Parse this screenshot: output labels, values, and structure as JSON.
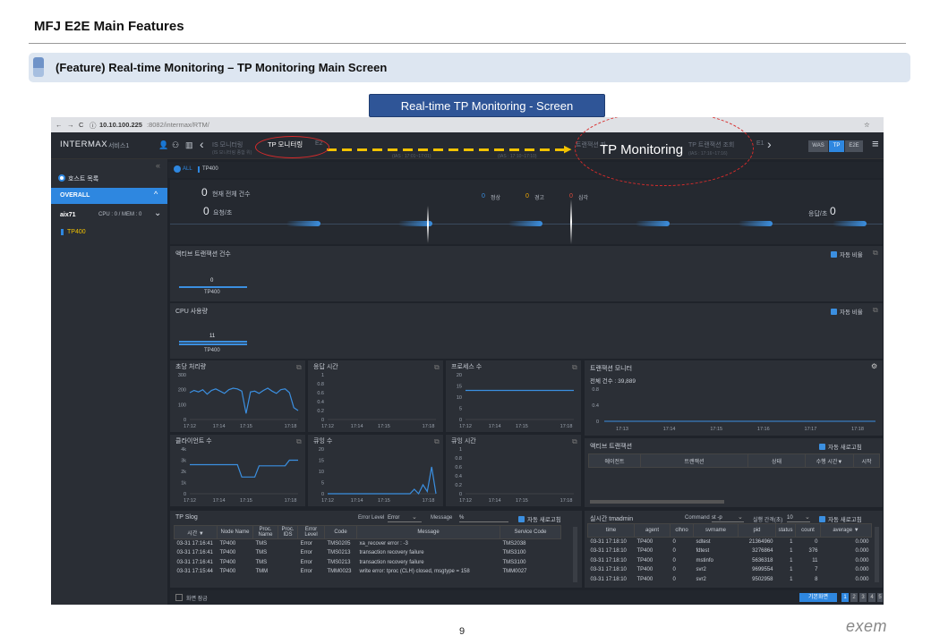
{
  "slide": {
    "title": "MFJ E2E Main Features",
    "feature_heading": "(Feature) Real-time Monitoring – TP Monitoring Main Screen",
    "screen_label": "Real-time TP Monitoring - Screen",
    "page_number": "9",
    "logo": "exem",
    "callout": "TP Monitoring"
  },
  "browser": {
    "url_host": "10.10.100.225",
    "url_rest": ":8082/intermax/RTM/"
  },
  "app": {
    "brand": "INTERMAX",
    "service": "서비스1",
    "nav_items": [
      "IS 모니터링",
      "TP 모니터링",
      "E2",
      "트랜잭션 파",
      "TP 트랜잭션 조회",
      "E1"
    ],
    "nav_sub": [
      "(IS 모니터링 종합 위)",
      "(IAS : 17:01~17:01)",
      "(IAS : 17:10~17:10)",
      "(IAS : 17:16~17:16)"
    ],
    "view_buttons": [
      "WAS",
      "TP",
      "E2E"
    ]
  },
  "sidebar": {
    "host_list": "호스트 목록",
    "overall": "OVERALL",
    "host": "aix71",
    "host_stats": "CPU : 0 / MEM : 0",
    "tp_item": "TP400"
  },
  "filter": {
    "all": "ALL",
    "tp": "TP400"
  },
  "summary": {
    "total_label": "현재 전체 건수",
    "total_value": "0",
    "req_label": "요청/초",
    "req_value": "0",
    "normal_value": "0",
    "normal_label": "정상",
    "warn_value": "0",
    "warn_label": "경고",
    "crit_value": "0",
    "crit_label": "심각",
    "resp_label": "응답/초",
    "resp_value": "0"
  },
  "active_panel": {
    "title": "액티브 트랜잭션 건수",
    "auto_ratio": "자동 비율",
    "value": "0",
    "server": "TP400"
  },
  "cpu_panel": {
    "title": "CPU 사용량",
    "auto_ratio": "자동 비율",
    "value": "11",
    "server": "TP400"
  },
  "chart_data": [
    {
      "type": "line",
      "title": "초당 처리량",
      "x": [
        "17:12",
        "17:14",
        "17:15",
        "17:18"
      ],
      "ylim": [
        0,
        300
      ],
      "yticks": [
        "300",
        "200",
        "100",
        "0"
      ],
      "values": [
        180,
        195,
        185,
        200,
        170,
        195,
        205,
        190,
        175,
        200,
        210,
        205,
        190,
        40,
        185,
        190,
        175,
        195,
        210,
        190,
        175,
        200,
        205,
        180,
        80,
        60
      ]
    },
    {
      "type": "line",
      "title": "응답 시간",
      "x": [
        "17:12",
        "17:14",
        "17:15",
        "17:18"
      ],
      "ylim": [
        0,
        1
      ],
      "yticks": [
        "1",
        "0.8",
        "0.6",
        "0.4",
        "0.2",
        "0"
      ],
      "values": []
    },
    {
      "type": "line",
      "title": "프로세스 수",
      "x": [
        "17:12",
        "17:14",
        "17:15",
        "17:18"
      ],
      "ylim": [
        0,
        20
      ],
      "yticks": [
        "20",
        "15",
        "10",
        "5",
        "0"
      ],
      "values": [
        13,
        13,
        13,
        13,
        13,
        13,
        13,
        13,
        13,
        13,
        13,
        13,
        13,
        13
      ]
    },
    {
      "type": "line",
      "title": "클라이언트 수",
      "x": [
        "17:12",
        "17:14",
        "17:15",
        "17:18"
      ],
      "ylim": [
        0,
        4000
      ],
      "yticks": [
        "4k",
        "3k",
        "2k",
        "1k",
        "0"
      ],
      "values": [
        2600,
        2600,
        2600,
        2600,
        2600,
        2600,
        2600,
        2600,
        2600,
        2600,
        2600,
        2600,
        1500,
        1500,
        1500,
        1500,
        2500,
        2500,
        2500,
        2500,
        2500,
        2500,
        2500,
        3000,
        3000,
        3000
      ]
    },
    {
      "type": "line",
      "title": "큐잉 수",
      "x": [
        "17:12",
        "17:14",
        "17:15",
        "17:18"
      ],
      "ylim": [
        0,
        20
      ],
      "yticks": [
        "20",
        "15",
        "10",
        "5",
        "0"
      ],
      "values": [
        0,
        0,
        0,
        0,
        0,
        0,
        0,
        0,
        0,
        0,
        0,
        0,
        0,
        0,
        0,
        0,
        0,
        0,
        0,
        0,
        2,
        0,
        4,
        1,
        12,
        0
      ]
    },
    {
      "type": "line",
      "title": "큐잉 시간",
      "x": [
        "17:12",
        "17:14",
        "17:15",
        "17:18"
      ],
      "ylim": [
        0,
        1
      ],
      "yticks": [
        "1",
        "0.8",
        "0.6",
        "0.4",
        "0.2",
        "0"
      ],
      "values": []
    },
    {
      "type": "bar",
      "title": "트랜잭션 모니터",
      "total_label": "전체 건수 : 39,889",
      "x": [
        "17:13",
        "17:14",
        "17:15",
        "17:16",
        "17:17",
        "17:18"
      ],
      "ylim": [
        0,
        1
      ],
      "yticks": [
        "0.8",
        "0.4",
        "0"
      ],
      "values": []
    }
  ],
  "active_txn": {
    "title": "액티브 트랜잭션",
    "auto_refresh": "자동 새로고침",
    "columns": [
      "에이전트",
      "트랜잭션",
      "상태",
      "수행 시간▼",
      "시작"
    ]
  },
  "slog": {
    "title": "TP Slog",
    "error_level_label": "Error Level",
    "error_level_value": "Error",
    "message_label": "Message",
    "message_value": "%",
    "auto_refresh": "자동 새로고침",
    "columns": [
      "시간 ▼",
      "Node Name",
      "Proc. Name",
      "Proc. IDS",
      "Error Level",
      "Code",
      "Message",
      "Service Code"
    ],
    "rows": [
      [
        "03-31 17:16:41",
        "TP400",
        "TMS",
        "",
        "Error",
        "TMS0205",
        "xa_recover error : -3",
        "TMS2038"
      ],
      [
        "03-31 17:16:41",
        "TP400",
        "TMS",
        "",
        "Error",
        "TMS0213",
        "transaction recovery failure",
        "TMS3100"
      ],
      [
        "03-31 17:16:41",
        "TP400",
        "TMS",
        "",
        "Error",
        "TMS0213",
        "transaction recovery failure",
        "TMS3100"
      ],
      [
        "03-31 17:15:44",
        "TP400",
        "TMM",
        "",
        "Error",
        "TMM0023",
        "write error: tproc (CLH) closed, msgtype = 158",
        "TMM0027"
      ]
    ],
    "full_screen": "화면 잠금"
  },
  "tmadmin": {
    "title": "실시간 tmadmin",
    "command_label": "Command",
    "command_value": "st -p",
    "interval_label": "실행 간격(초)",
    "interval_value": "10",
    "auto_refresh": "자동 새로고침",
    "columns": [
      "time",
      "agent",
      "clhno",
      "svrname",
      "pid",
      "status",
      "count",
      "average ▼"
    ],
    "rows": [
      [
        "03-31 17:18:10",
        "TP400",
        "0",
        "sdtest",
        "21364960",
        "1",
        "0",
        "0.000"
      ],
      [
        "03-31 17:18:10",
        "TP400",
        "0",
        "fdtest",
        "3276864",
        "1",
        "376",
        "0.000"
      ],
      [
        "03-31 17:18:10",
        "TP400",
        "0",
        "mstinfo",
        "5636318",
        "1",
        "11",
        "0.000"
      ],
      [
        "03-31 17:18:10",
        "TP400",
        "0",
        "svr2",
        "9699554",
        "1",
        "7",
        "0.000"
      ],
      [
        "03-31 17:18:10",
        "TP400",
        "0",
        "svr2",
        "9502958",
        "1",
        "8",
        "0.000"
      ]
    ],
    "pager_button": "기본화면",
    "pages": [
      "1",
      "2",
      "3",
      "4",
      "5"
    ]
  }
}
